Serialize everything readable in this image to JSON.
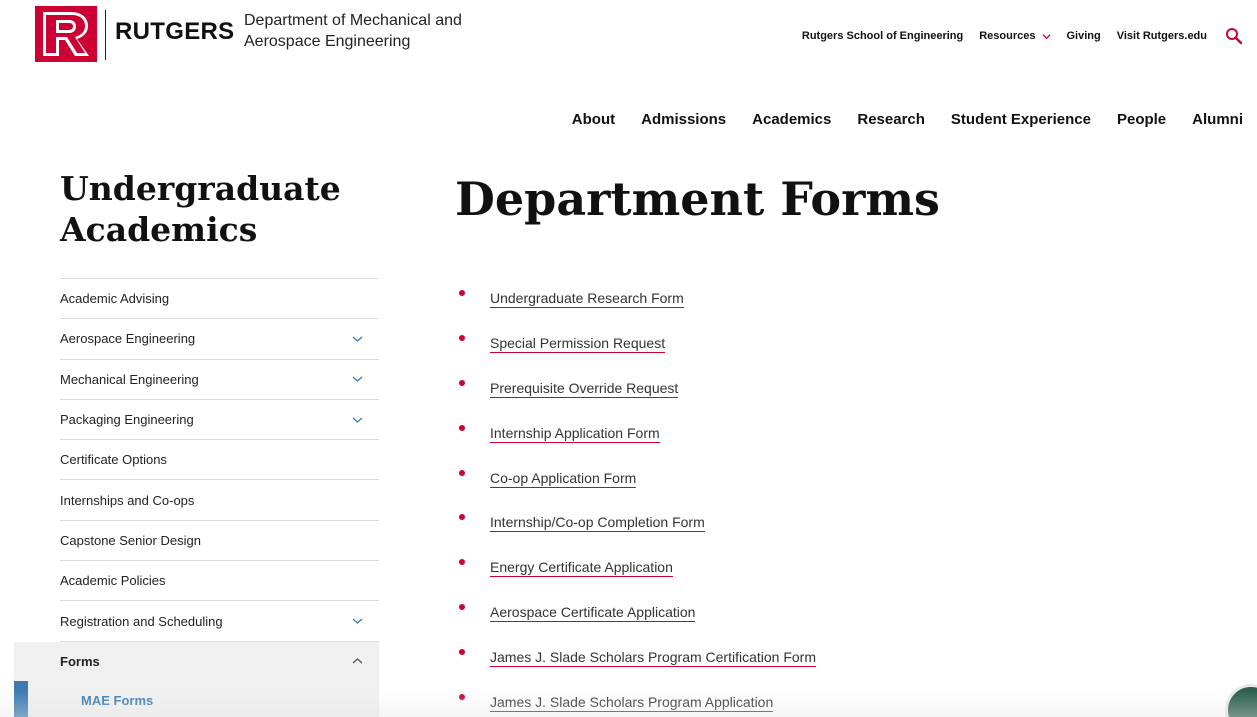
{
  "brand": {
    "logo_letter": "R",
    "logo_word": "RUTGERS",
    "department": "Department of Mechanical and Aerospace Engineering",
    "brand_color": "#cc0033"
  },
  "utility_nav": {
    "items": [
      {
        "label": "Rutgers School of Engineering"
      },
      {
        "label": "Resources",
        "icon": "chevron-down-icon"
      },
      {
        "label": "Giving"
      },
      {
        "label": "Visit Rutgers.edu"
      }
    ],
    "search_icon": "search-icon"
  },
  "main_nav": {
    "items": [
      "About",
      "Admissions",
      "Academics",
      "Research",
      "Student Experience",
      "People",
      "Alumni"
    ]
  },
  "sidebar": {
    "title": "Undergraduate Academics",
    "items": [
      {
        "label": "Academic Advising",
        "expandable": false
      },
      {
        "label": "Aerospace Engineering",
        "expandable": true
      },
      {
        "label": "Mechanical Engineering",
        "expandable": true
      },
      {
        "label": "Packaging Engineering",
        "expandable": true
      },
      {
        "label": "Certificate Options",
        "expandable": false
      },
      {
        "label": "Internships and Co-ops",
        "expandable": false
      },
      {
        "label": "Capstone Senior Design",
        "expandable": false
      },
      {
        "label": "Academic Policies",
        "expandable": false
      },
      {
        "label": "Registration and Scheduling",
        "expandable": true
      },
      {
        "label": "Forms",
        "expandable": true,
        "expanded": true
      }
    ],
    "sub_item": {
      "label": "MAE Forms",
      "active_color": "#3a7bb2"
    }
  },
  "main": {
    "title": "Department Forms",
    "forms": [
      "Undergraduate Research Form",
      "Special Permission Request",
      "Prerequisite Override Request",
      "Internship Application Form",
      "Co-op Application Form",
      "Internship/Co-op Completion Form",
      "Energy Certificate Application",
      "Aerospace Certificate Application",
      "James J. Slade Scholars Program Certification Form",
      "James J. Slade Scholars Program Application"
    ]
  }
}
